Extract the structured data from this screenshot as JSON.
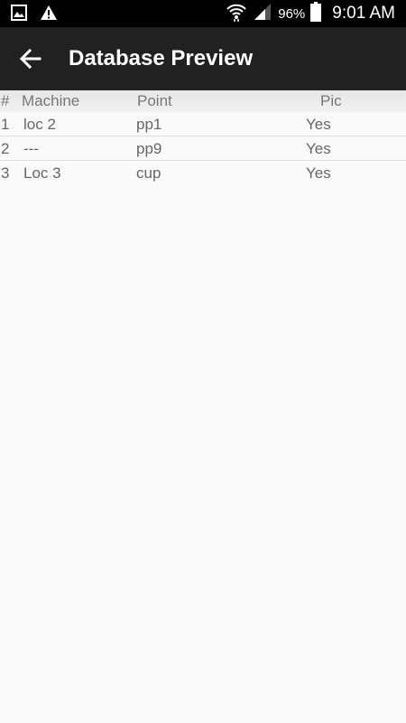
{
  "status_bar": {
    "icons_left": [
      "image-notification-icon",
      "warning-icon"
    ],
    "battery": "96%",
    "time": "9:01 AM"
  },
  "app_bar": {
    "title": "Database Preview",
    "back_icon": "arrow-left-icon"
  },
  "table": {
    "headers": [
      "#",
      "Machine",
      "Point",
      "Pic"
    ],
    "rows": [
      {
        "num": "1",
        "machine": "loc 2",
        "point": "pp1",
        "pic": "Yes"
      },
      {
        "num": "2",
        "machine": "---",
        "point": "pp9",
        "pic": "Yes"
      },
      {
        "num": "3",
        "machine": "Loc 3",
        "point": "cup",
        "pic": "Yes"
      }
    ]
  }
}
